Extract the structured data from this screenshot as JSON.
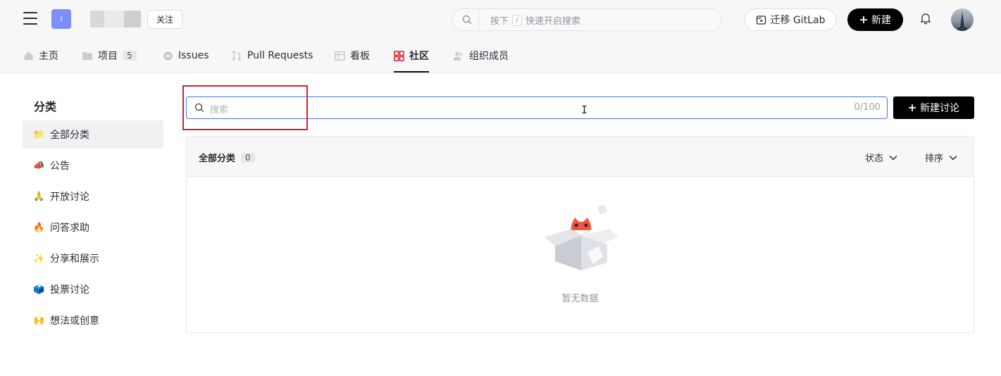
{
  "header": {
    "org_avatar_letter": "I",
    "follow_label": "关注",
    "search_hint_prefix": "按下",
    "search_hint_key": "/",
    "search_hint_suffix": "快速开启搜索",
    "migrate_label": "迁移 GitLab",
    "new_label": "新建"
  },
  "tabs": [
    {
      "label": "主页",
      "icon": "home-icon"
    },
    {
      "label": "项目",
      "icon": "folder-icon",
      "count": "5"
    },
    {
      "label": "Issues",
      "icon": "issues-icon"
    },
    {
      "label": "Pull Requests",
      "icon": "pull-request-icon"
    },
    {
      "label": "看板",
      "icon": "board-icon"
    },
    {
      "label": "社区",
      "icon": "community-icon",
      "active": true
    },
    {
      "label": "组织成员",
      "icon": "members-icon"
    }
  ],
  "sidebar": {
    "title": "分类",
    "items": [
      {
        "label": "全部分类",
        "emoji": "📁",
        "active": true
      },
      {
        "label": "公告",
        "emoji": "📣"
      },
      {
        "label": "开放讨论",
        "emoji": "🙏"
      },
      {
        "label": "问答求助",
        "emoji": "🔥"
      },
      {
        "label": "分享和展示",
        "emoji": "✨"
      },
      {
        "label": "投票讨论",
        "emoji": "🗳️"
      },
      {
        "label": "想法或创意",
        "emoji": "🙌"
      }
    ]
  },
  "main": {
    "search_placeholder": "搜索",
    "search_count": "0/100",
    "new_discussion_label": "新建讨论",
    "panel_title": "全部分类",
    "panel_count": "0",
    "status_filter": "状态",
    "sort_filter": "排序",
    "empty_text": "暂无数据"
  },
  "colors": {
    "accent": "#4a70f0",
    "highlight": "#d0212b",
    "community_icon": "#e0283a"
  }
}
